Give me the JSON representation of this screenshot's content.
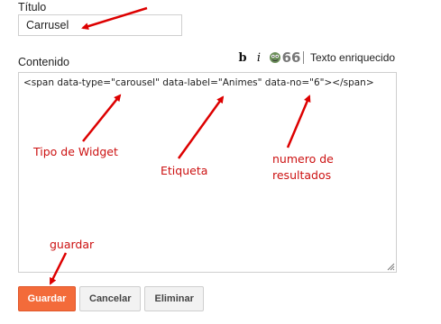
{
  "form": {
    "title_label": "Título",
    "title_value": "Carrusel",
    "content_label": "Contenido",
    "code_value": "<span data-type=\"carousel\" data-label=\"Animes\" data-no=\"6\"></span>"
  },
  "toolbar": {
    "bold_glyph": "b",
    "italic_glyph": "i",
    "image_icon": "image-icon",
    "quote_glyph": "66",
    "rich_text_label": "Texto enriquecido"
  },
  "annotations": {
    "widget_type": "Tipo de Widget",
    "label": "Etiqueta",
    "results_line1": "numero de",
    "results_line2": "resultados",
    "save": "guardar",
    "color": "#cc1111"
  },
  "buttons": {
    "save": "Guardar",
    "cancel": "Cancelar",
    "delete": "Eliminar",
    "primary_color": "#f36b3a"
  }
}
